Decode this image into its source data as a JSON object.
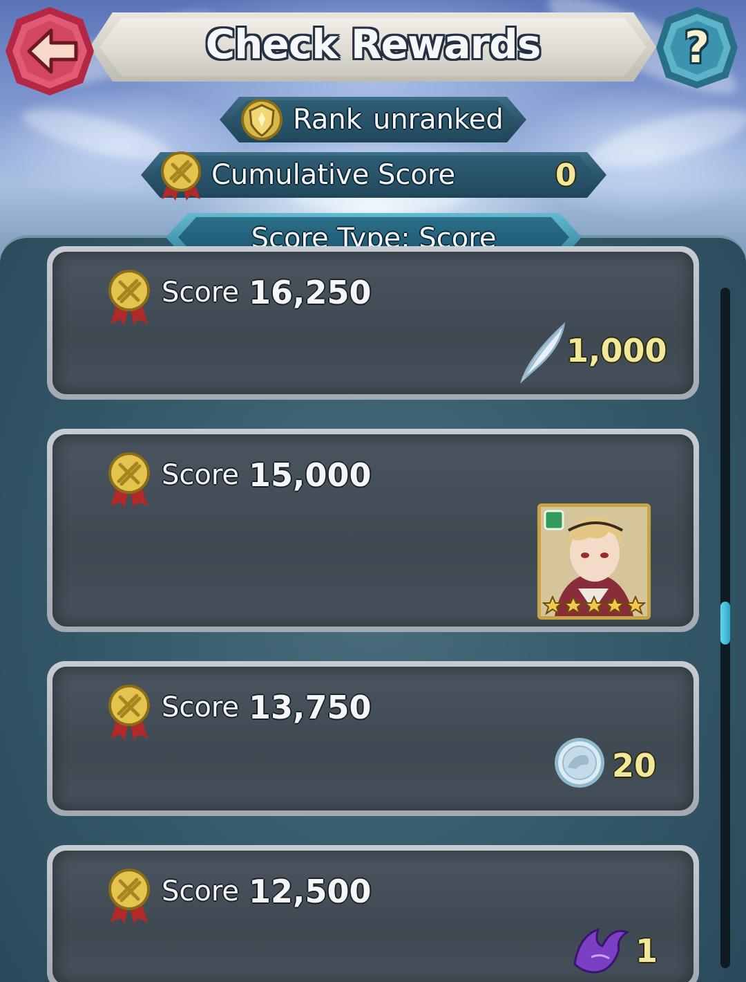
{
  "header": {
    "title": "Check Rewards",
    "back_icon": "back-arrow-icon",
    "help_icon": "question-mark-icon",
    "help_label": "?"
  },
  "rank": {
    "label": "Rank",
    "value": "unranked",
    "icon": "rank-shield-icon"
  },
  "cumulative": {
    "label": "Cumulative Score",
    "value": "0",
    "icon": "score-medal-icon"
  },
  "score_type": {
    "label": "Score Type: Score"
  },
  "rewards": [
    {
      "score_label": "Score",
      "score_value": "16,250",
      "reward_icon": "feather-icon",
      "reward_qty": "1,000"
    },
    {
      "score_label": "Score",
      "score_value": "15,000",
      "reward_icon": "hero-portrait",
      "reward_qty": "",
      "hero_stars": 5
    },
    {
      "score_label": "Score",
      "score_value": "13,750",
      "reward_icon": "sacred-coin-icon",
      "reward_qty": "20"
    },
    {
      "score_label": "Score",
      "score_value": "12,500",
      "reward_icon": "dragon-emblem-icon",
      "reward_qty": "1"
    }
  ],
  "colors": {
    "accent_gold": "#f3e79a",
    "panel": "#35596a",
    "card": "#434d57",
    "back_button": "#d84a63",
    "help_button": "#3e8ea8"
  }
}
